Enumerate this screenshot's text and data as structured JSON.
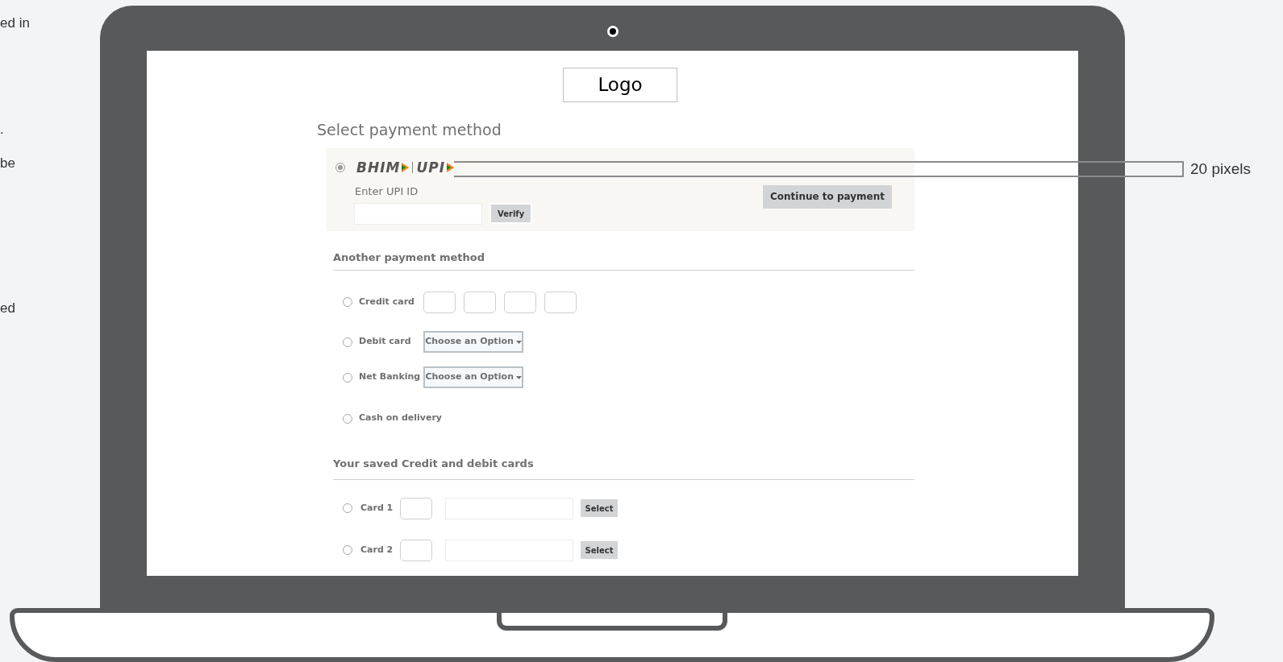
{
  "side_notes": [
    "ed in",
    ".",
    "be",
    "ed"
  ],
  "logo": "Logo",
  "heading": "Select payment method",
  "upi": {
    "selected": true,
    "brand": [
      "BHIM",
      "UPI"
    ],
    "label": "Enter UPI ID",
    "verify": "Verify",
    "continue": "Continue to payment"
  },
  "another": {
    "title": "Another payment method",
    "options": [
      {
        "kind": "card_number",
        "label": "Credit card",
        "selected": false
      },
      {
        "kind": "dropdown",
        "label": "Debit card",
        "selected": false,
        "value": "Choose an Option"
      },
      {
        "kind": "dropdown",
        "label": "Net Banking",
        "selected": false,
        "value": "Choose an Option"
      },
      {
        "kind": "plain",
        "label": "Cash on delivery",
        "selected": false
      }
    ]
  },
  "saved": {
    "title": "Your saved Credit and debit cards",
    "cards": [
      {
        "label": "Card 1",
        "selected": false,
        "button": "Select"
      },
      {
        "label": "Card 2",
        "selected": false,
        "button": "Select"
      }
    ]
  },
  "annotation": {
    "text": "20 pixels"
  }
}
